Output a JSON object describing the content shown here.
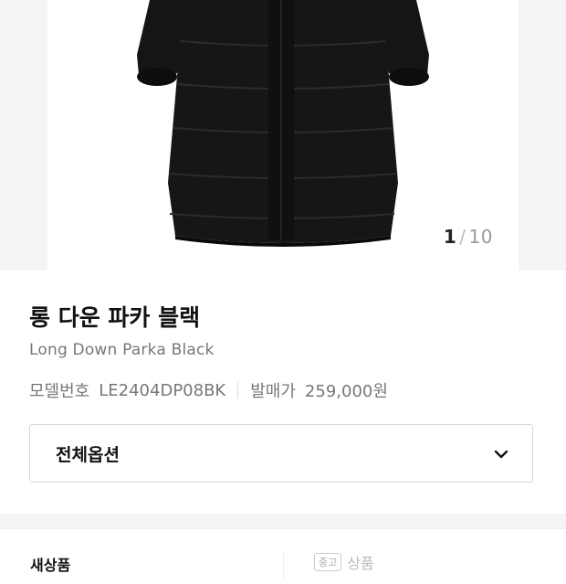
{
  "gallery": {
    "current": "1",
    "separator": "/",
    "total": "10"
  },
  "product": {
    "name_ko": "롱 다운 파카 블랙",
    "name_en": "Long Down Parka Black"
  },
  "details": {
    "model_label": "모델번호",
    "model_value": "LE2404DP08BK",
    "price_label": "발매가",
    "price_value": "259,000원"
  },
  "options": {
    "label": "전체옵션",
    "icon": "chevron-down-icon"
  },
  "condition_tabs": {
    "new_label": "새상품",
    "used_badge": "중고",
    "used_label": "상품"
  }
}
